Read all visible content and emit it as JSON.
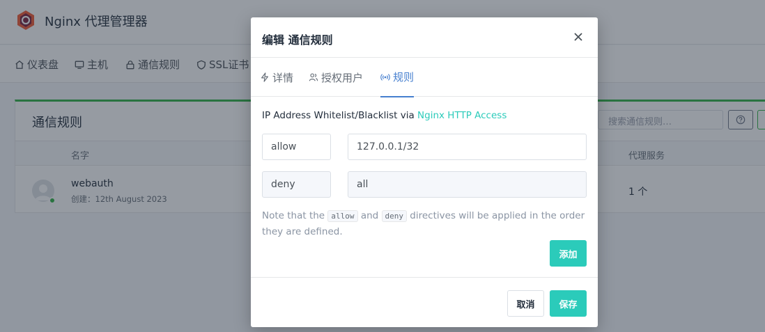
{
  "app": {
    "title": "Nginx 代理管理器",
    "nav": [
      {
        "label": "仪表盘",
        "icon": "home-icon"
      },
      {
        "label": "主机",
        "icon": "monitor-icon"
      },
      {
        "label": "通信规则",
        "icon": "lock-icon"
      },
      {
        "label": "SSL证书",
        "icon": "shield-icon"
      }
    ]
  },
  "list": {
    "title": "通信规则",
    "search_placeholder": "搜索通信规则…",
    "columns": {
      "name": "名字",
      "proxy": "代理服务"
    },
    "rows": [
      {
        "name": "webauth",
        "created": "创建：12th August 2023",
        "proxy_count": "1 个"
      }
    ]
  },
  "modal": {
    "title": "编辑 通信规则",
    "tabs": [
      {
        "label": "详情",
        "icon": "bolt-icon",
        "active": false
      },
      {
        "label": "授权用户",
        "icon": "users-icon",
        "active": false
      },
      {
        "label": "规则",
        "icon": "radio-icon",
        "active": true
      }
    ],
    "description_prefix": "IP Address Whitelist/Blacklist via ",
    "description_link": "Nginx HTTP Access",
    "rules": [
      {
        "directive": "allow",
        "address": "127.0.0.1/32"
      },
      {
        "directive": "deny",
        "address": "all"
      }
    ],
    "note": {
      "part1": "Note that the ",
      "code1": "allow",
      "part2": " and ",
      "code2": "deny",
      "part3": " directives will be applied in the order they are defined."
    },
    "add_label": "添加",
    "cancel_label": "取消",
    "save_label": "保存"
  },
  "colors": {
    "accent": "#2bcbba",
    "active_tab": "#467fcf",
    "status_online": "#2fb344"
  }
}
